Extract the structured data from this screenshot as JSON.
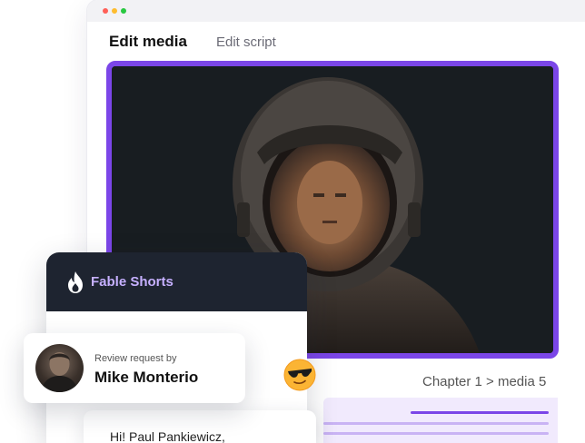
{
  "editor": {
    "tabs": [
      {
        "label": "Edit media",
        "active": true
      },
      {
        "label": "Edit script",
        "active": false
      }
    ],
    "preview": {
      "subject": "astronaut helmet portrait"
    },
    "chapter_label": "Chapter 1 > media 5",
    "accent_color": "#7b46e8"
  },
  "fable_card": {
    "brand": "Fable Shorts",
    "header_color": "#1e2430",
    "brand_color": "#c6b0ff"
  },
  "review_request": {
    "subtitle": "Review request by",
    "name": "Mike Monterio"
  },
  "message": {
    "text": "Hi! Paul Pankiewicz,"
  },
  "icons": [
    "flame-icon",
    "sunglasses-emoji-icon",
    "window-close-dot",
    "window-minimize-dot",
    "window-maximize-dot"
  ]
}
